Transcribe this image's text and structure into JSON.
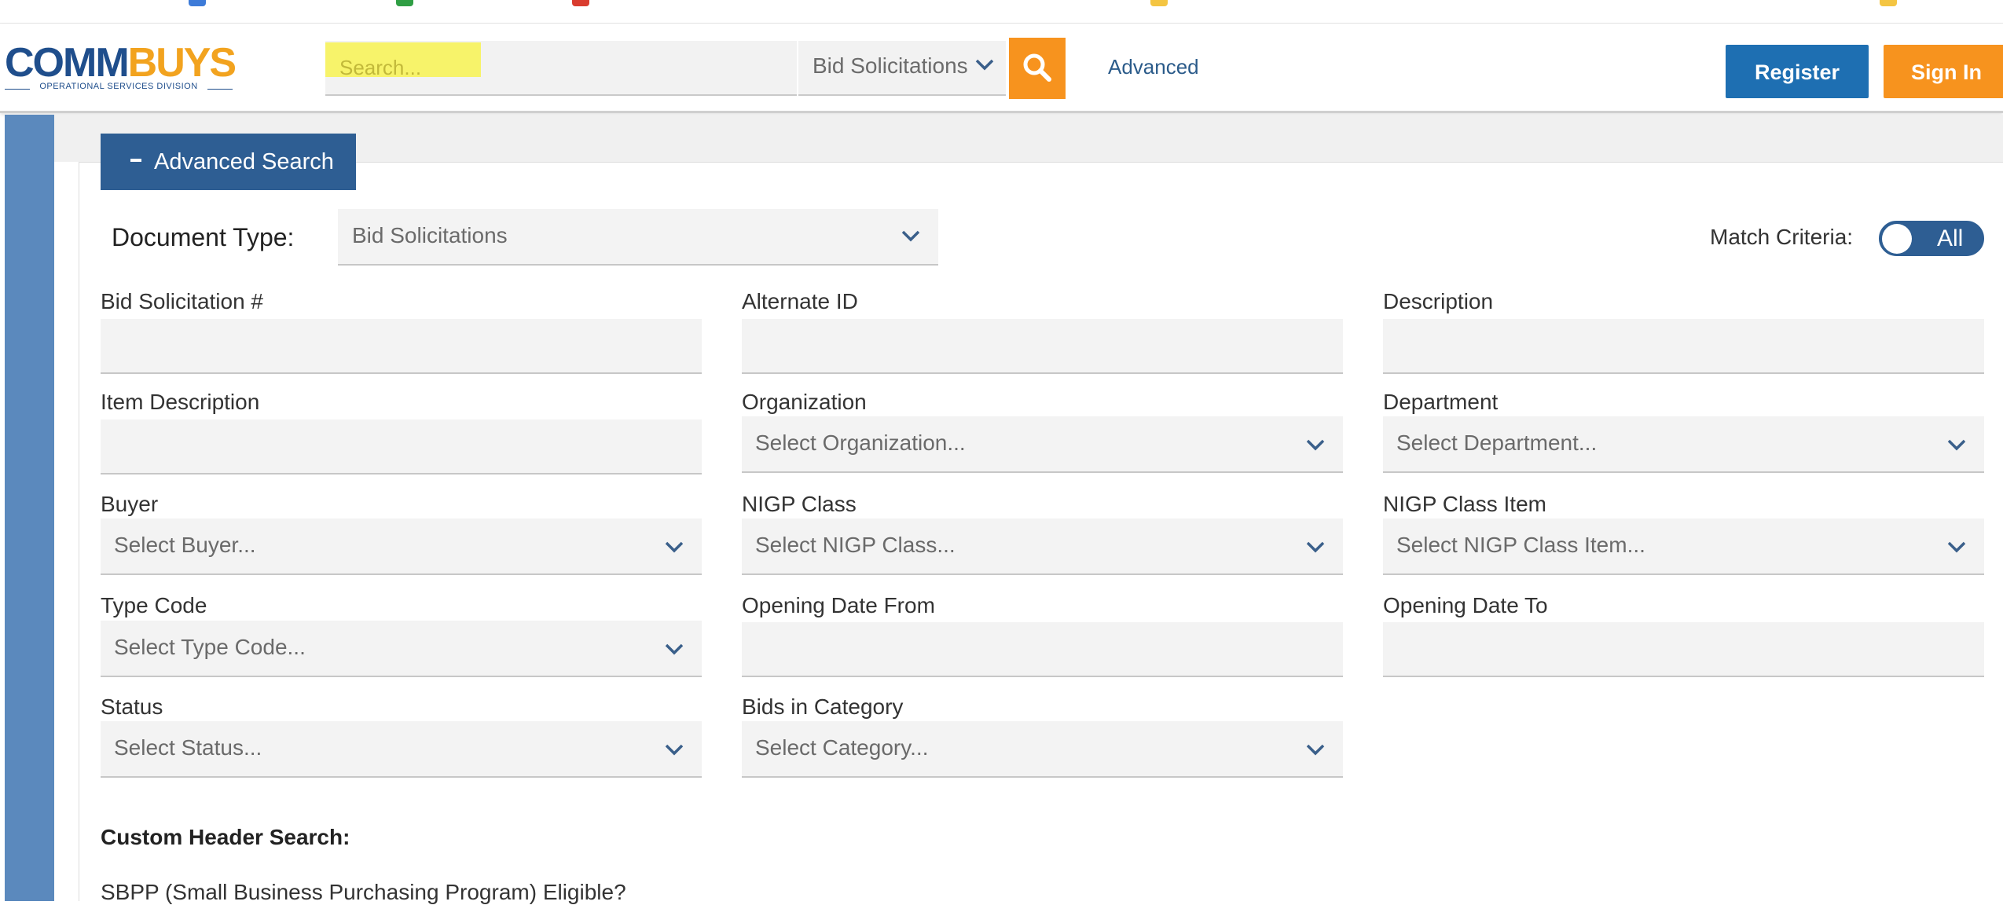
{
  "header": {
    "logo_main_part1": "COMM",
    "logo_main_part2": "BUYS",
    "logo_subtitle": "OPERATIONAL SERVICES DIVISION",
    "search_placeholder": "Search...",
    "search_doc_type": "Bid Solicitations",
    "advanced_link": "Advanced",
    "register_label": "Register",
    "signin_label": "Sign In"
  },
  "advanced_search": {
    "toggle_label": "Advanced Search",
    "document_type_label": "Document Type:",
    "document_type_value": "Bid Solicitations",
    "match_criteria_label": "Match Criteria:",
    "match_criteria_value": "All",
    "fields": {
      "bid_solicitation_num": {
        "label": "Bid Solicitation #",
        "value": ""
      },
      "alternate_id": {
        "label": "Alternate ID",
        "value": ""
      },
      "description": {
        "label": "Description",
        "value": ""
      },
      "item_description": {
        "label": "Item Description",
        "value": ""
      },
      "organization": {
        "label": "Organization",
        "placeholder": "Select Organization..."
      },
      "department": {
        "label": "Department",
        "placeholder": "Select Department..."
      },
      "buyer": {
        "label": "Buyer",
        "placeholder": "Select Buyer..."
      },
      "nigp_class": {
        "label": "NIGP Class",
        "placeholder": "Select NIGP Class..."
      },
      "nigp_class_item": {
        "label": "NIGP Class Item",
        "placeholder": "Select NIGP Class Item..."
      },
      "type_code": {
        "label": "Type Code",
        "placeholder": "Select Type Code..."
      },
      "opening_date_from": {
        "label": "Opening Date From",
        "value": ""
      },
      "opening_date_to": {
        "label": "Opening Date To",
        "value": ""
      },
      "status": {
        "label": "Status",
        "placeholder": "Select Status..."
      },
      "bids_in_category": {
        "label": "Bids in Category",
        "placeholder": "Select Category..."
      }
    },
    "custom_header_label": "Custom Header Search:",
    "sbpp_label": "SBPP (Small Business Purchasing Program) Eligible?"
  },
  "colors": {
    "brand_blue": "#1f4e8c",
    "brand_orange": "#f7931e",
    "register_blue": "#1e6fb2",
    "panel_blue": "#2e5e93",
    "rail_blue": "#5b89bd"
  }
}
